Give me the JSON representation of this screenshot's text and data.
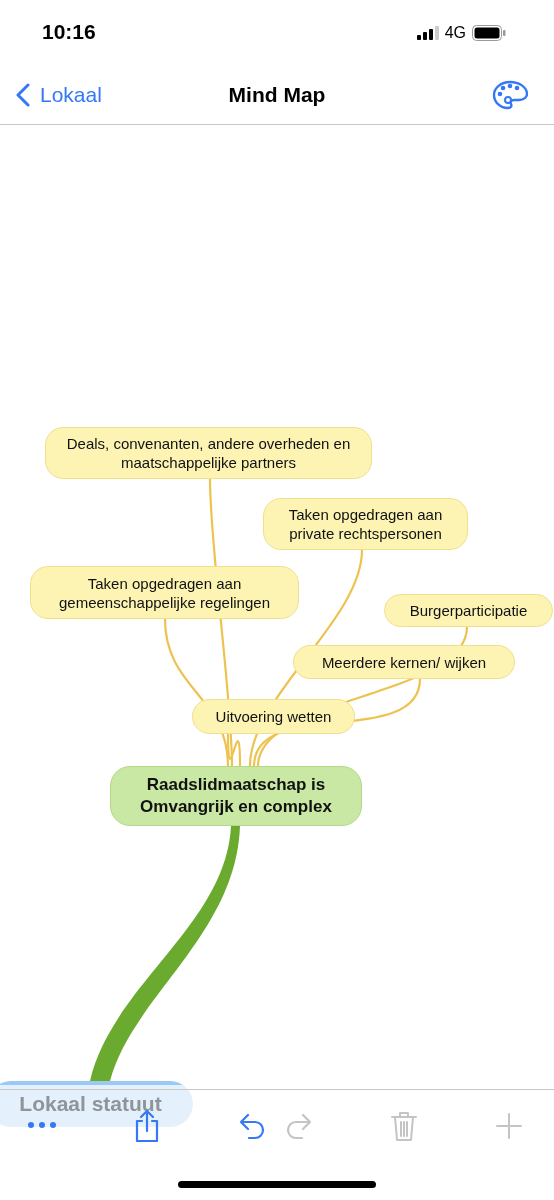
{
  "status_bar": {
    "time": "10:16",
    "network": "4G"
  },
  "nav": {
    "back_label": "Lokaal",
    "title": "Mind Map"
  },
  "mind_map": {
    "root": {
      "text": "Lokaal statuut",
      "children": [
        {
          "text": "Raadslidmaatschap is Omvangrijk en complex",
          "children": [
            {
              "text": "Deals, convenanten, andere overheden en maatschappelijke partners"
            },
            {
              "text": "Taken opgedragen aan private rechtspersonen"
            },
            {
              "text": "Taken opgedragen aan gemeenschappelijke regelingen"
            },
            {
              "text": "Burgerparticipatie"
            },
            {
              "text": "Meerdere kernen/ wijken"
            },
            {
              "text": "Uitvoering wetten"
            }
          ]
        }
      ]
    }
  },
  "toolbar": [
    {
      "kind": "more",
      "disabled": false
    },
    {
      "kind": "share",
      "disabled": false
    },
    {
      "kind": "undo",
      "disabled": false
    },
    {
      "kind": "redo",
      "disabled": true
    },
    {
      "kind": "delete",
      "disabled": true
    },
    {
      "kind": "add",
      "disabled": true
    }
  ]
}
